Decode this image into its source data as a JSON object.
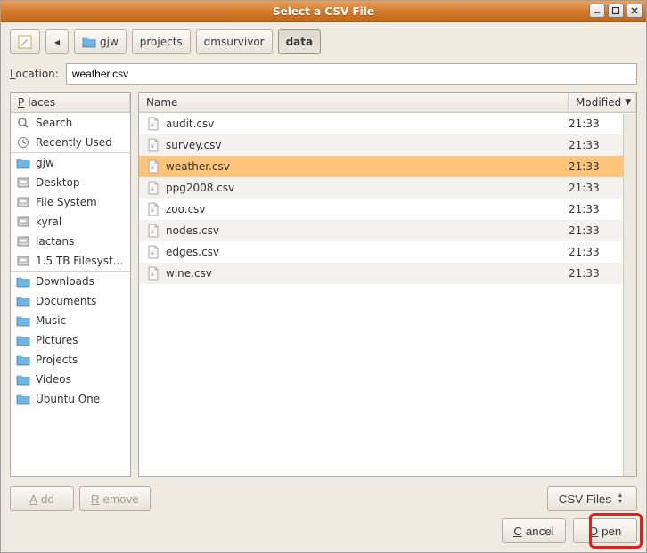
{
  "window": {
    "title": "Select a CSV File"
  },
  "pathbar": {
    "segments": [
      {
        "label": "gjw",
        "icon": "folder",
        "active": false
      },
      {
        "label": "projects",
        "active": false
      },
      {
        "label": "dmsurvivor",
        "active": false
      },
      {
        "label": "data",
        "active": true
      }
    ]
  },
  "location": {
    "label": "Location:",
    "value": "weather.csv"
  },
  "places": {
    "header": "Places",
    "items": [
      {
        "label": "Search",
        "icon": "search"
      },
      {
        "label": "Recently Used",
        "icon": "clock"
      },
      {
        "label": "gjw",
        "icon": "folder",
        "sep": true
      },
      {
        "label": "Desktop",
        "icon": "disk"
      },
      {
        "label": "File System",
        "icon": "disk"
      },
      {
        "label": "kyral",
        "icon": "disk"
      },
      {
        "label": "lactans",
        "icon": "disk"
      },
      {
        "label": "1.5 TB Filesyst...",
        "icon": "disk"
      },
      {
        "label": "Downloads",
        "icon": "folder",
        "sep": true
      },
      {
        "label": "Documents",
        "icon": "folder"
      },
      {
        "label": "Music",
        "icon": "folder"
      },
      {
        "label": "Pictures",
        "icon": "folder"
      },
      {
        "label": "Projects",
        "icon": "folder"
      },
      {
        "label": "Videos",
        "icon": "folder"
      },
      {
        "label": "Ubuntu One",
        "icon": "folder"
      }
    ]
  },
  "files": {
    "columns": {
      "name": "Name",
      "modified": "Modified"
    },
    "rows": [
      {
        "name": "audit.csv",
        "modified": "21:33",
        "selected": false
      },
      {
        "name": "survey.csv",
        "modified": "21:33",
        "selected": false
      },
      {
        "name": "weather.csv",
        "modified": "21:33",
        "selected": true
      },
      {
        "name": "ppg2008.csv",
        "modified": "21:33",
        "selected": false
      },
      {
        "name": "zoo.csv",
        "modified": "21:33",
        "selected": false
      },
      {
        "name": "nodes.csv",
        "modified": "21:33",
        "selected": false
      },
      {
        "name": "edges.csv",
        "modified": "21:33",
        "selected": false
      },
      {
        "name": "wine.csv",
        "modified": "21:33",
        "selected": false
      }
    ]
  },
  "buttons": {
    "add": "Add",
    "remove": "Remove",
    "filter": "CSV Files",
    "cancel": "Cancel",
    "open": "Open"
  }
}
